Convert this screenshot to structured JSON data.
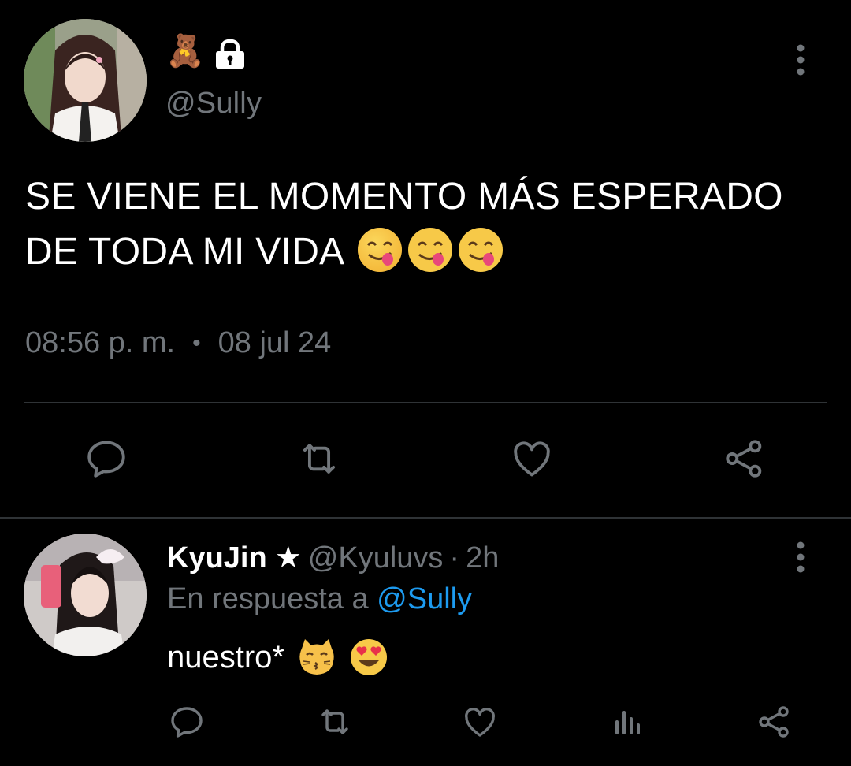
{
  "main_tweet": {
    "emoji_name": "🧸",
    "handle": "@Sully",
    "text_line1": "SE VIENE EL MOMENTO MÁS ESPERADO",
    "text_line2": "DE TODA MI VIDA",
    "emojis": [
      "yum-face-icon",
      "yum-face-icon",
      "yum-face-icon"
    ],
    "time": "08:56 p. m.",
    "separator": "•",
    "date": "08 jul 24",
    "actions": [
      "reply-icon",
      "retweet-icon",
      "heart-icon",
      "share-icon"
    ],
    "locked": true
  },
  "reply": {
    "name": "KyuJin",
    "star": "★",
    "handle": "@Kyuluvs",
    "separator": "·",
    "time": "2h",
    "in_reply_prefix": "En respuesta a",
    "in_reply_handle": "@Sully",
    "text": "nuestro*",
    "emojis": [
      "kissing-cat-icon",
      "heart-eyes-icon"
    ],
    "actions": [
      "reply-icon",
      "retweet-icon",
      "heart-icon",
      "analytics-icon",
      "share-icon"
    ]
  },
  "colors": {
    "background": "#000000",
    "text_primary": "#ffffff",
    "text_secondary": "#71767b",
    "link": "#1d9bf0",
    "divider": "#2f3336",
    "icon": "#71767b"
  }
}
